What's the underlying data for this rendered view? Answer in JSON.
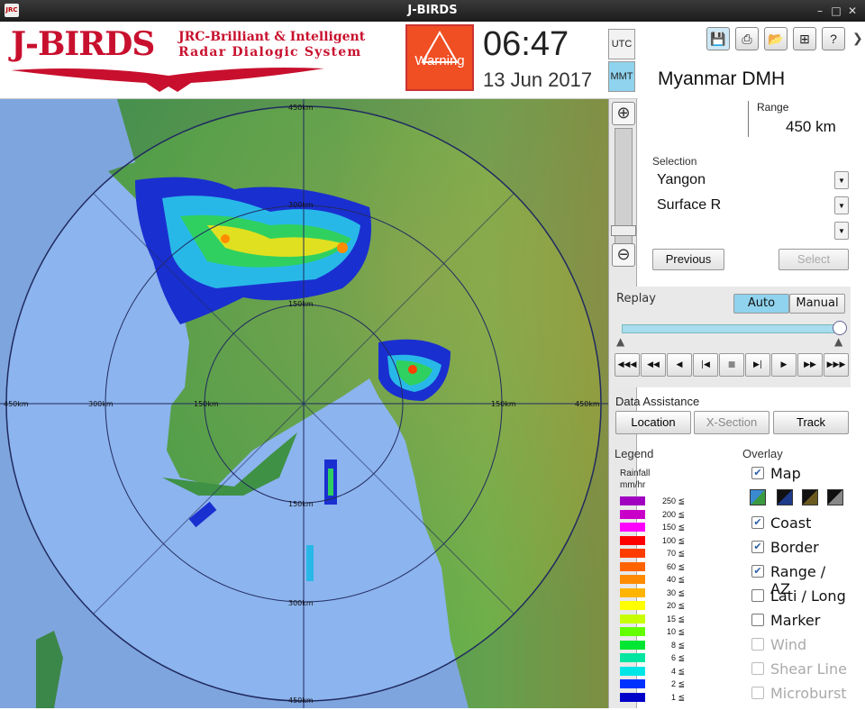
{
  "window": {
    "title": "J-BIRDS",
    "app_icon_text": "JRC"
  },
  "header": {
    "logo_text": "J-BIRDS",
    "logo_sub1": "JRC-Brilliant & Intelligent",
    "logo_sub2": "Radar Dialogic System",
    "warning_label": "Warning",
    "time": "06:47",
    "date": "13 Jun 2017",
    "tz_utc": "UTC",
    "tz_mmt": "MMT"
  },
  "map": {
    "range_labels": [
      "450km",
      "300km",
      "150km",
      "150km",
      "300km",
      "450km",
      "450km",
      "300km",
      "150km",
      "150km",
      "300km",
      "450km"
    ]
  },
  "panel": {
    "station": "Myanmar DMH",
    "range_label": "Range",
    "range_value": "450 km",
    "selection_label": "Selection",
    "selection_site": "Yangon",
    "selection_product": "Surface R",
    "selection_third": "",
    "previous_label": "Previous",
    "select_label": "Select",
    "replay_label": "Replay",
    "auto_label": "Auto",
    "manual_label": "Manual",
    "replay_progress": 1.0,
    "data_assist_label": "Data Assistance",
    "location_label": "Location",
    "xsection_label": "X-Section",
    "track_label": "Track",
    "legend_label": "Legend",
    "legend_sub1": "Rainfall",
    "legend_sub2": "mm/hr",
    "legend": [
      {
        "v": "250 ≦",
        "c": "#a000c0"
      },
      {
        "v": "200 ≦",
        "c": "#c800c8"
      },
      {
        "v": "150 ≦",
        "c": "#ff00ff"
      },
      {
        "v": "100 ≦",
        "c": "#ff0000"
      },
      {
        "v": "70 ≦",
        "c": "#ff3c00"
      },
      {
        "v": "60 ≦",
        "c": "#ff6400"
      },
      {
        "v": "40 ≦",
        "c": "#ff8c00"
      },
      {
        "v": "30 ≦",
        "c": "#ffb400"
      },
      {
        "v": "20 ≦",
        "c": "#ffff00"
      },
      {
        "v": "15 ≦",
        "c": "#c8ff00"
      },
      {
        "v": "10 ≦",
        "c": "#64ff00"
      },
      {
        "v": "8 ≦",
        "c": "#00e632"
      },
      {
        "v": "6 ≦",
        "c": "#00e6a0"
      },
      {
        "v": "4 ≦",
        "c": "#00e6e6"
      },
      {
        "v": "2 ≦",
        "c": "#0032ff"
      },
      {
        "v": "1 ≦",
        "c": "#0000c8"
      }
    ],
    "overlay_label": "Overlay",
    "overlays": [
      {
        "label": "Map",
        "checked": true,
        "enabled": true
      },
      {
        "label": "Coast",
        "checked": true,
        "enabled": true
      },
      {
        "label": "Border",
        "checked": true,
        "enabled": true
      },
      {
        "label": "Range / AZ",
        "checked": true,
        "enabled": true
      },
      {
        "label": "Lati / Long",
        "checked": false,
        "enabled": true
      },
      {
        "label": "Marker",
        "checked": false,
        "enabled": true
      },
      {
        "label": "Wind",
        "checked": false,
        "enabled": false
      },
      {
        "label": "Shear Line",
        "checked": false,
        "enabled": false
      },
      {
        "label": "Microburst",
        "checked": false,
        "enabled": false
      }
    ]
  }
}
